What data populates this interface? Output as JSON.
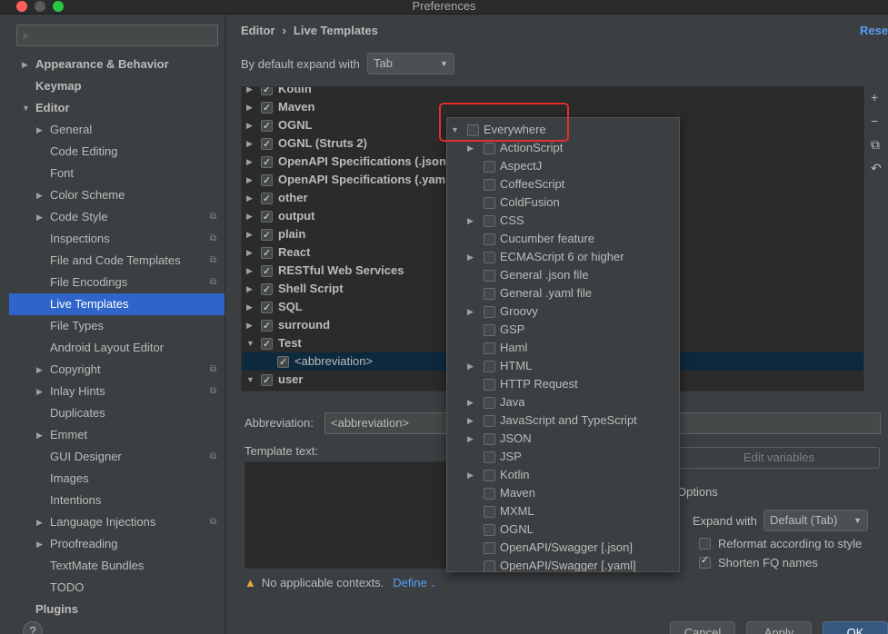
{
  "window": {
    "title": "Preferences"
  },
  "sidebar": {
    "search_placeholder": "",
    "items": [
      {
        "label": "Appearance & Behavior",
        "indent": 0,
        "arrow": "right",
        "bold": true
      },
      {
        "label": "Keymap",
        "indent": 0,
        "arrow": "",
        "bold": true
      },
      {
        "label": "Editor",
        "indent": 0,
        "arrow": "down",
        "bold": true
      },
      {
        "label": "General",
        "indent": 1,
        "arrow": "right"
      },
      {
        "label": "Code Editing",
        "indent": 1,
        "arrow": ""
      },
      {
        "label": "Font",
        "indent": 1,
        "arrow": ""
      },
      {
        "label": "Color Scheme",
        "indent": 1,
        "arrow": "right"
      },
      {
        "label": "Code Style",
        "indent": 1,
        "arrow": "right",
        "copy": true
      },
      {
        "label": "Inspections",
        "indent": 1,
        "arrow": "",
        "copy": true
      },
      {
        "label": "File and Code Templates",
        "indent": 1,
        "arrow": "",
        "copy": true
      },
      {
        "label": "File Encodings",
        "indent": 1,
        "arrow": "",
        "copy": true
      },
      {
        "label": "Live Templates",
        "indent": 1,
        "arrow": "",
        "selected": true
      },
      {
        "label": "File Types",
        "indent": 1,
        "arrow": ""
      },
      {
        "label": "Android Layout Editor",
        "indent": 1,
        "arrow": ""
      },
      {
        "label": "Copyright",
        "indent": 1,
        "arrow": "right",
        "copy": true
      },
      {
        "label": "Inlay Hints",
        "indent": 1,
        "arrow": "right",
        "copy": true
      },
      {
        "label": "Duplicates",
        "indent": 1,
        "arrow": ""
      },
      {
        "label": "Emmet",
        "indent": 1,
        "arrow": "right"
      },
      {
        "label": "GUI Designer",
        "indent": 1,
        "arrow": "",
        "copy": true
      },
      {
        "label": "Images",
        "indent": 1,
        "arrow": ""
      },
      {
        "label": "Intentions",
        "indent": 1,
        "arrow": ""
      },
      {
        "label": "Language Injections",
        "indent": 1,
        "arrow": "right",
        "copy": true
      },
      {
        "label": "Proofreading",
        "indent": 1,
        "arrow": "right"
      },
      {
        "label": "TextMate Bundles",
        "indent": 1,
        "arrow": ""
      },
      {
        "label": "TODO",
        "indent": 1,
        "arrow": ""
      },
      {
        "label": "Plugins",
        "indent": 0,
        "arrow": "",
        "bold": true
      }
    ],
    "help_label": "?"
  },
  "main": {
    "breadcrumb": [
      "Editor",
      "Live Templates"
    ],
    "reset_label": "Reset",
    "expand_label": "By default expand with",
    "expand_value": "Tab",
    "templates": [
      {
        "label": "Kotlin",
        "arrow": "right",
        "checked": true,
        "level": 0
      },
      {
        "label": "Maven",
        "arrow": "right",
        "checked": true,
        "level": 0
      },
      {
        "label": "OGNL",
        "arrow": "right",
        "checked": true,
        "level": 0
      },
      {
        "label": "OGNL (Struts 2)",
        "arrow": "right",
        "checked": true,
        "level": 0
      },
      {
        "label": "OpenAPI Specifications (.json)",
        "arrow": "right",
        "checked": true,
        "level": 0
      },
      {
        "label": "OpenAPI Specifications (.yaml)",
        "arrow": "right",
        "checked": true,
        "level": 0
      },
      {
        "label": "other",
        "arrow": "right",
        "checked": true,
        "level": 0
      },
      {
        "label": "output",
        "arrow": "right",
        "checked": true,
        "level": 0
      },
      {
        "label": "plain",
        "arrow": "right",
        "checked": true,
        "level": 0
      },
      {
        "label": "React",
        "arrow": "right",
        "checked": true,
        "level": 0
      },
      {
        "label": "RESTful Web Services",
        "arrow": "right",
        "checked": true,
        "level": 0
      },
      {
        "label": "Shell Script",
        "arrow": "right",
        "checked": true,
        "level": 0
      },
      {
        "label": "SQL",
        "arrow": "right",
        "checked": true,
        "level": 0
      },
      {
        "label": "surround",
        "arrow": "right",
        "checked": true,
        "level": 0
      },
      {
        "label": "Test",
        "arrow": "down",
        "checked": true,
        "level": 0
      },
      {
        "label": "<abbreviation>",
        "arrow": "",
        "checked": true,
        "level": 1,
        "selected": true
      },
      {
        "label": "user",
        "arrow": "down",
        "checked": true,
        "level": 0
      }
    ],
    "tools": [
      "+",
      "−",
      "⧉",
      "↶"
    ],
    "abbreviation_label": "Abbreviation:",
    "abbreviation_value": "<abbreviation>",
    "template_text_label": "Template text:",
    "edit_variables_label": "Edit variables",
    "options_label": "Options",
    "expand_with_label": "Expand with",
    "expand_with_value": "Default (Tab)",
    "reformat_label": "Reformat according to style",
    "shorten_label": "Shorten FQ names",
    "warning_text": "No applicable contexts.",
    "define_label": "Define",
    "buttons": {
      "cancel": "Cancel",
      "apply": "Apply",
      "ok": "OK"
    }
  },
  "context_popup": {
    "items": [
      {
        "label": "Everywhere",
        "arrow": "down",
        "level": 0
      },
      {
        "label": "ActionScript",
        "arrow": "right",
        "level": 1
      },
      {
        "label": "AspectJ",
        "arrow": "",
        "level": 1
      },
      {
        "label": "CoffeeScript",
        "arrow": "",
        "level": 1
      },
      {
        "label": "ColdFusion",
        "arrow": "",
        "level": 1
      },
      {
        "label": "CSS",
        "arrow": "right",
        "level": 1
      },
      {
        "label": "Cucumber feature",
        "arrow": "",
        "level": 1
      },
      {
        "label": "ECMAScript 6 or higher",
        "arrow": "right",
        "level": 1
      },
      {
        "label": "General .json file",
        "arrow": "",
        "level": 1
      },
      {
        "label": "General .yaml file",
        "arrow": "",
        "level": 1
      },
      {
        "label": "Groovy",
        "arrow": "right",
        "level": 1
      },
      {
        "label": "GSP",
        "arrow": "",
        "level": 1
      },
      {
        "label": "Haml",
        "arrow": "",
        "level": 1
      },
      {
        "label": "HTML",
        "arrow": "right",
        "level": 1
      },
      {
        "label": "HTTP Request",
        "arrow": "",
        "level": 1
      },
      {
        "label": "Java",
        "arrow": "right",
        "level": 1
      },
      {
        "label": "JavaScript and TypeScript",
        "arrow": "right",
        "level": 1
      },
      {
        "label": "JSON",
        "arrow": "right",
        "level": 1
      },
      {
        "label": "JSP",
        "arrow": "",
        "level": 1
      },
      {
        "label": "Kotlin",
        "arrow": "right",
        "level": 1
      },
      {
        "label": "Maven",
        "arrow": "",
        "level": 1
      },
      {
        "label": "MXML",
        "arrow": "",
        "level": 1
      },
      {
        "label": "OGNL",
        "arrow": "",
        "level": 1
      },
      {
        "label": "OpenAPI/Swagger [.json]",
        "arrow": "",
        "level": 1
      },
      {
        "label": "OpenAPI/Swagger [.yaml]",
        "arrow": "",
        "level": 1
      }
    ]
  }
}
